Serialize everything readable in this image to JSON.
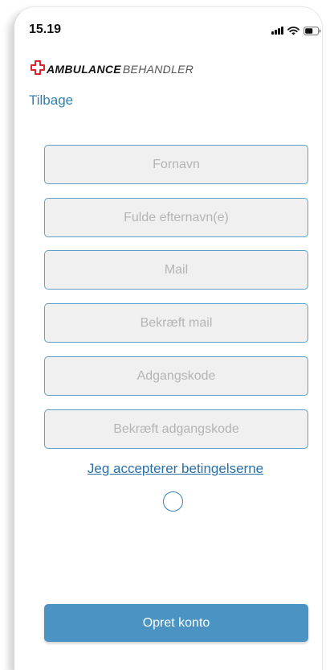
{
  "status_bar": {
    "time": "15.19",
    "icons": [
      "signal-icon",
      "wifi-icon",
      "battery-icon"
    ]
  },
  "header": {
    "logo_icon": "red-cross-icon",
    "logo_text_bold": "AMBULANCE",
    "logo_text_light": "BEHANDLER",
    "back_label": "Tilbage"
  },
  "form": {
    "first_name": {
      "placeholder": "Fornavn",
      "value": ""
    },
    "last_name": {
      "placeholder": "Fulde efternavn(e)",
      "value": ""
    },
    "email": {
      "placeholder": "Mail",
      "value": ""
    },
    "email_confirm": {
      "placeholder": "Bekræft mail",
      "value": ""
    },
    "password": {
      "placeholder": "Adgangskode",
      "value": ""
    },
    "password_confirm": {
      "placeholder": "Bekræft adgangskode",
      "value": ""
    },
    "terms_label": "Jeg accepterer betingelserne",
    "terms_accepted": false,
    "submit_label": "Opret konto"
  },
  "colors": {
    "accent": "#4b93c3",
    "link": "#2f7fb0",
    "field_border": "#5fa0c8",
    "field_background": "#f0f0f0",
    "logo_red": "#d7262b"
  }
}
